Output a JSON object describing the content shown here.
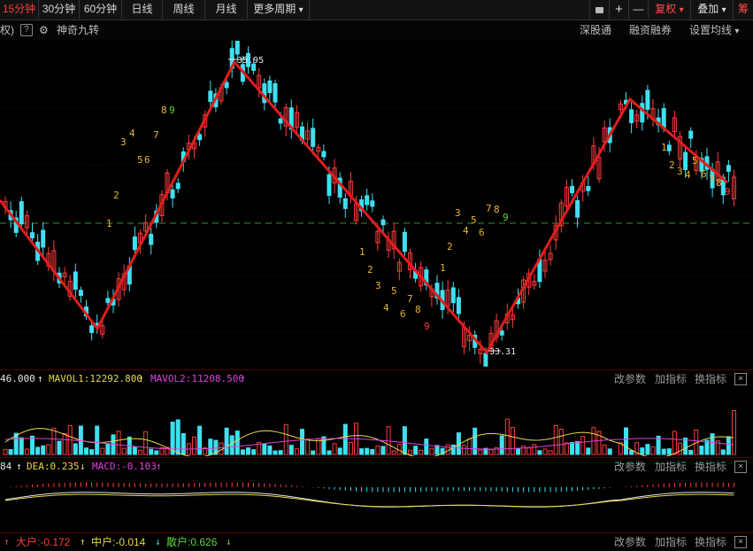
{
  "toolbar": {
    "periods": [
      "15分钟",
      "30分钟",
      "60分钟",
      "日线",
      "周线",
      "月线",
      "更多周期"
    ],
    "active_period": "15分钟",
    "more_arrow": "▾",
    "lock_icon": "🔒",
    "plus": "+",
    "minus": "—",
    "restore_right": "复权",
    "overlay": "叠加",
    "last_btn": "筹"
  },
  "subbar": {
    "left_fragment": "权)",
    "question": "?",
    "indicator": "神奇九转",
    "right_items": [
      "深股通",
      "融资融券",
      "设置均线"
    ]
  },
  "main_chart": {
    "high_label": "35.95",
    "low_label": "33.31",
    "td_labels": [
      {
        "t": "1",
        "c": "#e7b532"
      },
      {
        "t": "2",
        "c": "#e7b532"
      },
      {
        "t": "3",
        "c": "#e7b532"
      },
      {
        "t": "4",
        "c": "#e7b532"
      },
      {
        "t": "5",
        "c": "#e7b532"
      },
      {
        "t": "6",
        "c": "#e7b532"
      },
      {
        "t": "7",
        "c": "#e7b532"
      },
      {
        "t": "8",
        "c": "#e7b532"
      },
      {
        "t": "9",
        "c": "#5fd33a"
      },
      {
        "t": "1",
        "c": "#e7b532"
      },
      {
        "t": "2",
        "c": "#e7b532"
      },
      {
        "t": "3",
        "c": "#e7b532"
      },
      {
        "t": "4",
        "c": "#e7b532"
      },
      {
        "t": "5",
        "c": "#e7b532"
      },
      {
        "t": "6",
        "c": "#e7b532"
      },
      {
        "t": "7",
        "c": "#e7b532"
      },
      {
        "t": "8",
        "c": "#e7b532"
      },
      {
        "t": "9",
        "c": "#ff3b3b"
      },
      {
        "t": "1",
        "c": "#e7b532"
      },
      {
        "t": "2",
        "c": "#e7b532"
      },
      {
        "t": "3",
        "c": "#e7b532"
      },
      {
        "t": "4",
        "c": "#e7b532"
      },
      {
        "t": "5",
        "c": "#e7b532"
      },
      {
        "t": "6",
        "c": "#e7b532"
      },
      {
        "t": "7",
        "c": "#e7b532"
      },
      {
        "t": "8",
        "c": "#e7b532"
      },
      {
        "t": "9",
        "c": "#5fd33a"
      },
      {
        "t": "1",
        "c": "#e7b532"
      },
      {
        "t": "2",
        "c": "#e7b532"
      },
      {
        "t": "3",
        "c": "#e7b532"
      },
      {
        "t": "4",
        "c": "#e7b532"
      },
      {
        "t": "5",
        "c": "#e7b532"
      },
      {
        "t": "6",
        "c": "#e7b532"
      },
      {
        "t": "7",
        "c": "#e7b532"
      },
      {
        "t": "8",
        "c": "#e7b532"
      },
      {
        "t": "9",
        "c": "#ff3b3b"
      }
    ]
  },
  "volume_panel": {
    "vol": "46.000",
    "ma1": "MAVOL1:12292.800",
    "ma2": "MAVOL2:11208.500",
    "arrow_up": "↑",
    "actions": [
      "改参数",
      "加指标",
      "换指标"
    ],
    "close": "×"
  },
  "macd_panel": {
    "dif": "84",
    "dea": "DEA:0.235",
    "macd": "MACD:-0.103",
    "arrow_down": "↓",
    "arrow_up": "↑",
    "actions": [
      "改参数",
      "加指标",
      "换指标"
    ],
    "close": "×"
  },
  "fund_panel": {
    "big": "大户:-0.172",
    "mid": "中户:-0.014",
    "small": "散户:0.626",
    "actions": [
      "改参数",
      "加指标",
      "换指标"
    ],
    "close": "×"
  },
  "colors": {
    "up": "#ff3b3b",
    "down": "#3fe0f0",
    "trend": "#e11d1d",
    "ma_white": "#e8e8e8",
    "ma_magenta": "#e040e0",
    "ma_yellow": "#e8d84a"
  }
}
